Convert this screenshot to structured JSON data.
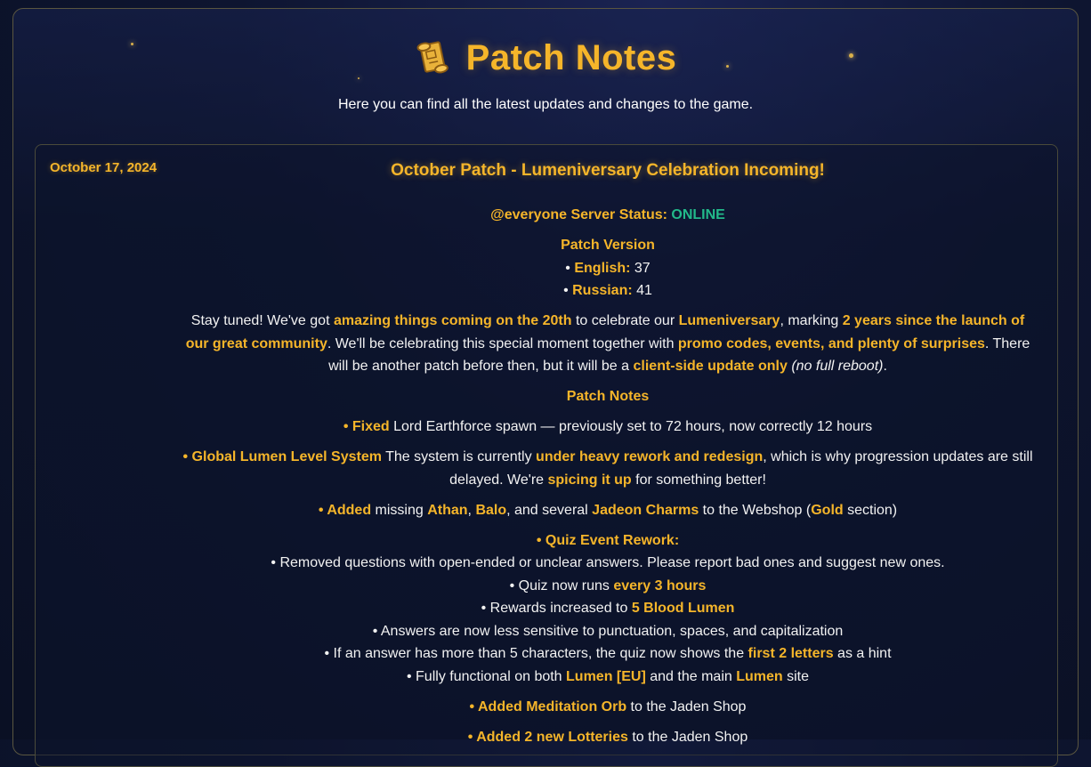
{
  "header": {
    "title": "Patch Notes",
    "subtitle": "Here you can find all the latest updates and changes to the game.",
    "icon": "scroll-icon"
  },
  "patch": {
    "date": "October 17, 2024",
    "title": "October Patch - Lumeniversary Celebration Incoming!",
    "status_prefix": "@everyone Server Status:",
    "status_value": "ONLINE",
    "version_heading": "Patch Version",
    "versions": [
      {
        "bullet": "• ",
        "label": "English:",
        "value": " 37"
      },
      {
        "bullet": "• ",
        "label": "Russian:",
        "value": " 41"
      }
    ],
    "intro": {
      "t1": "Stay tuned! We've got ",
      "h1": "amazing things coming on the 20th",
      "t2": " to celebrate our ",
      "h2": "Lumeniversary",
      "t3": ", marking ",
      "h3": "2 years since the launch of our great community",
      "t4": ". We'll be celebrating this special moment together with ",
      "h4": "promo codes, events, and plenty of surprises",
      "t5": ". There will be another patch before then, but it will be a ",
      "h5": "client-side update only",
      "t6": " ",
      "i1": "(no full reboot)",
      "t7": "."
    },
    "notes_heading": "Patch Notes",
    "note1": {
      "b": "•  ",
      "h": "Fixed",
      "t": " Lord Earthforce spawn — previously set to 72 hours, now correctly 12 hours"
    },
    "note2": {
      "b": "•  ",
      "h1": "Global Lumen Level System",
      "t1": " The system is currently ",
      "h2": "under heavy rework and redesign",
      "t2": ", which is why progression updates are still delayed. We're ",
      "h3": "spicing it up",
      "t3": " for something better!"
    },
    "note3": {
      "b": "•  ",
      "h1": "Added",
      "t1": " missing ",
      "h2": "Athan",
      "t2": ", ",
      "h3": "Balo",
      "t3": ", and several ",
      "h4": "Jadeon Charms",
      "t4": " to the Webshop (",
      "h5": "Gold",
      "t5": " section)"
    },
    "quiz": {
      "b": "•  ",
      "heading": "Quiz Event Rework:",
      "l1": "• Removed questions with open-ended or unclear answers. Please report bad ones and suggest new ones.",
      "l2_t": "• Quiz now runs ",
      "l2_h": "every 3 hours",
      "l3_t": "• Rewards increased to ",
      "l3_h": "5 Blood Lumen",
      "l4": "• Answers are now less sensitive to punctuation, spaces, and capitalization",
      "l5_t1": "• If an answer has more than 5 characters, the quiz now shows the ",
      "l5_h": "first 2 letters",
      "l5_t2": " as a hint",
      "l6_t1": "• Fully functional on both ",
      "l6_h1": "Lumen [EU]",
      "l6_t2": " and the main ",
      "l6_h2": "Lumen",
      "l6_t3": " site"
    },
    "note5": {
      "b": "•  ",
      "h": "Added Meditation Orb",
      "t": " to the Jaden Shop"
    },
    "note6": {
      "b": "•  ",
      "h": "Added 2 new Lotteries",
      "t": " to the Jaden Shop"
    }
  },
  "colors": {
    "accent": "#f5b52a",
    "online": "#22b98a",
    "background": "#0e1530"
  }
}
